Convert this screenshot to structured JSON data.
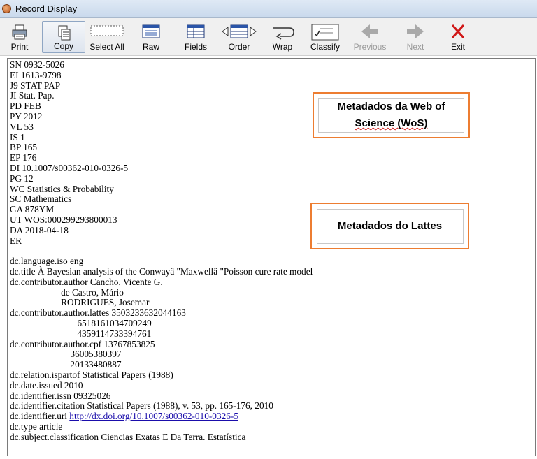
{
  "window": {
    "title": "Record Display"
  },
  "toolbar": {
    "print": "Print",
    "copy": "Copy",
    "select_all": "Select All",
    "raw": "Raw",
    "fields": "Fields",
    "order": "Order",
    "wrap": "Wrap",
    "classify": "Classify",
    "previous": "Previous",
    "next": "Next",
    "exit": "Exit"
  },
  "record": {
    "wos_lines": [
      "SN 0932-5026",
      "EI 1613-9798",
      "J9 STAT PAP",
      "JI Stat. Pap.",
      "PD FEB",
      "PY 2012",
      "VL 53",
      "IS 1",
      "BP 165",
      "EP 176",
      "DI 10.1007/s00362-010-0326-5",
      "PG 12",
      "WC Statistics & Probability",
      "SC Mathematics",
      "GA 878YM",
      "UT WOS:000299293800013",
      "DA 2018-04-18",
      "ER"
    ],
    "lattes_lines": [
      "dc.language.iso eng",
      "dc.title À Bayesian analysis of the Conwayâ \"Maxwellâ \"Poisson cure rate model",
      "dc.contributor.author Cancho, Vicente G.",
      "                      de Castro, Mário",
      "                      RODRIGUES, Josemar",
      "dc.contributor.author.lattes 3503233632044163",
      "                             6518161034709249",
      "                             4359114733394761",
      "dc.contributor.author.cpf 13767853825",
      "                          36005380397",
      "                          20133480887",
      "dc.relation.ispartof Statistical Papers (1988)",
      "dc.date.issued 2010",
      "dc.identifier.issn 09325026",
      "dc.identifier.citation Statistical Papers (1988), v. 53, pp. 165-176, 2010"
    ],
    "uri_prefix": "dc.identifier.uri ",
    "uri": "http://dx.doi.org/10.1007/s00362-010-0326-5",
    "tail_lines": [
      "dc.type article",
      "dc.subject.classification Ciencias Exatas E Da Terra. Estatística"
    ]
  },
  "annotations": {
    "wos_line1": "Metadados da Web of",
    "wos_line2": "Science (WoS)",
    "lattes": "Metadados do Lattes",
    "accent_color": "#ed7d31"
  }
}
